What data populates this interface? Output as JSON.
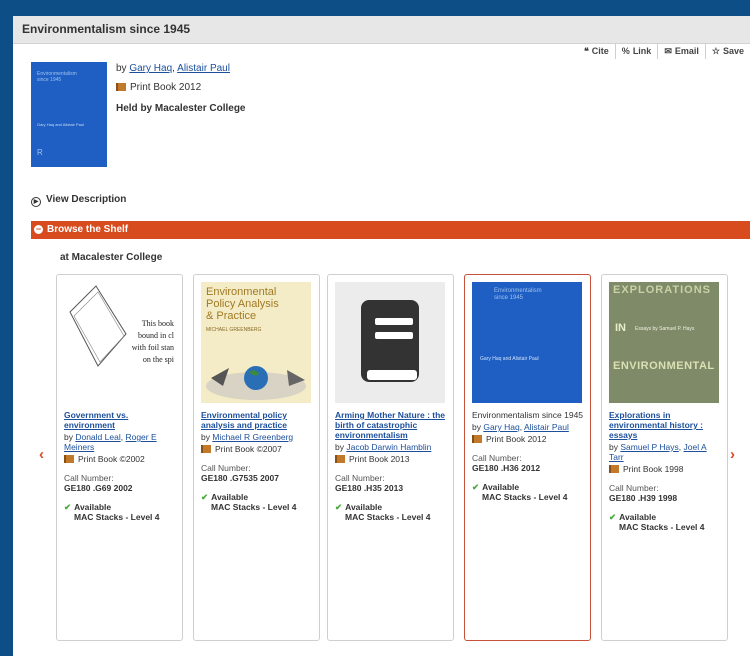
{
  "record": {
    "title": "Environmentalism since 1945",
    "by": "by",
    "authors": [
      "Gary Haq",
      "Alistair Paul"
    ],
    "format": "Print Book 2012",
    "held": "Held by Macalester College"
  },
  "actions": [
    {
      "icon": "quote-icon",
      "glyph": "❝",
      "label": "Cite"
    },
    {
      "icon": "link-icon",
      "glyph": "%",
      "label": "Link"
    },
    {
      "icon": "email-icon",
      "glyph": "✉",
      "label": "Email"
    },
    {
      "icon": "star-icon",
      "glyph": "☆",
      "label": "Save"
    }
  ],
  "view_description": "View Description",
  "browse_shelf": "Browse the Shelf",
  "at_library": "at Macalester College",
  "nav": {
    "prev": "‹",
    "next": "›"
  },
  "items": [
    {
      "title": "Government vs. environment",
      "authors": [
        "Donald Leal",
        "Roger E Meiners"
      ],
      "format": "Print Book ©2002",
      "call_label": "Call Number:",
      "call_number": "GE180 .G69 2002",
      "status": "Available",
      "location": "MAC Stacks - Level 4",
      "cover_text": [
        "This book",
        "bound in cl",
        "with foil stan",
        "on the spi"
      ]
    },
    {
      "title": "Environmental policy analysis and practice",
      "authors": [
        "Michael R Greenberg"
      ],
      "format": "Print Book ©2007",
      "call_label": "Call Number:",
      "call_number": "GE180 .G7535 2007",
      "status": "Available",
      "location": "MAC Stacks - Level 4",
      "cover_text": [
        "Environmental",
        "Policy Analysis",
        "& Practice",
        "MICHAEL GREENBERG"
      ]
    },
    {
      "title": "Arming Mother Nature : the birth of catastrophic environmentalism",
      "authors": [
        "Jacob Darwin Hamblin"
      ],
      "format": "Print Book 2013",
      "call_label": "Call Number:",
      "call_number": "GE180 .H35 2013",
      "status": "Available",
      "location": "MAC Stacks - Level 4"
    },
    {
      "title": "Environmentalism since 1945",
      "authors": [
        "Gary Haq",
        "Alistair Paul"
      ],
      "format": "Print Book 2012",
      "call_label": "Call Number:",
      "call_number": "GE180 .H36 2012",
      "status": "Available",
      "location": "MAC Stacks - Level 4",
      "cover_text": [
        "Environmentalism",
        "since 1945",
        "Gary Haq and Alistair Paul"
      ]
    },
    {
      "title": "Explorations in environmental history : essays",
      "authors": [
        "Samuel P Hays",
        "Joel A Tarr"
      ],
      "format": "Print Book 1998",
      "call_label": "Call Number:",
      "call_number": "GE180 .H39 1998",
      "status": "Available",
      "location": "MAC Stacks - Level 4",
      "cover_text": [
        "EXPLORATIONS",
        "IN",
        "ENVIRONMENTAL",
        "Essays by Samuel P. Hays"
      ]
    }
  ],
  "colors": {
    "accent": "#d74b1e",
    "link": "#1c4f9c",
    "frame": "#0d4e86",
    "available": "#4aa83f"
  }
}
